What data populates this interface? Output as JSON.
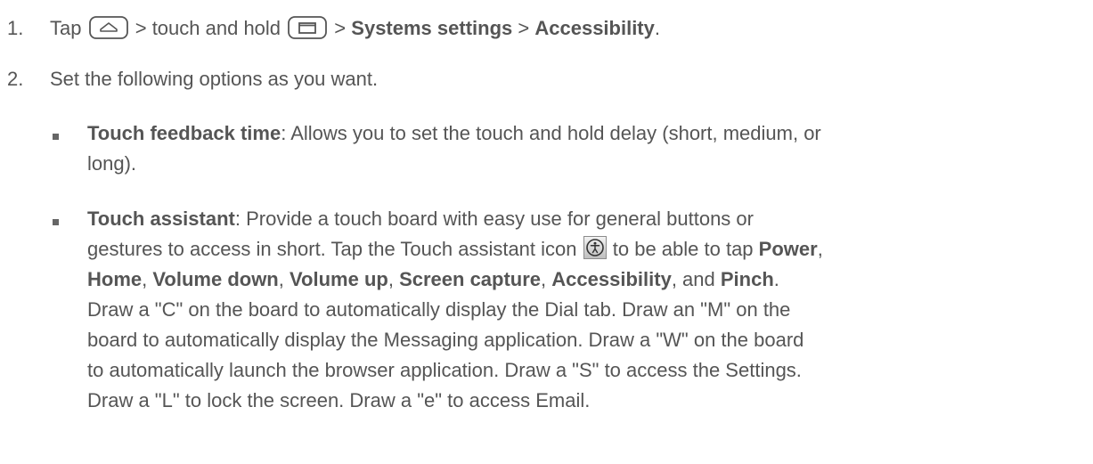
{
  "step1": {
    "number": "1.",
    "tap": "Tap",
    "sep1": "> touch and hold",
    "sep2": ">",
    "systems_settings": "Systems settings",
    "sep3": ">",
    "accessibility": "Accessibility",
    "period": ".",
    "home_key_icon": "home-key-icon",
    "recent_apps_key_icon": "recent-apps-key-icon"
  },
  "step2": {
    "number": "2.",
    "text": "Set the following options as you want."
  },
  "options": {
    "touch_feedback": {
      "title": "Touch feedback time",
      "line1": ": Allows you to set the touch and hold delay (short, medium, or",
      "line2": "long)."
    },
    "touch_assistant": {
      "title": "Touch assistant",
      "line1_rest": ": Provide a touch board with easy use for general buttons or",
      "line2_pre": "gestures to access in short. Tap the Touch assistant icon",
      "icon_name": "accessibility-icon",
      "line2_post": "to be able to tap",
      "power": "Power",
      "comma": ",",
      "home": "Home",
      "volume_down": "Volume down",
      "volume_up": "Volume up",
      "screen_capture": "Screen capture",
      "accessibility": "Accessibility",
      "and": ", and",
      "pinch": "Pinch",
      "period": ".",
      "line4": "Draw a \"C\" on the board to automatically display the Dial tab. Draw an \"M\" on the",
      "line5": "board to automatically display the Messaging application. Draw a \"W\" on the board",
      "line6": "to automatically launch the browser application. Draw a \"S\" to access the Settings.",
      "line7": "Draw a \"L\" to lock the screen. Draw a \"e\" to access Email."
    }
  }
}
